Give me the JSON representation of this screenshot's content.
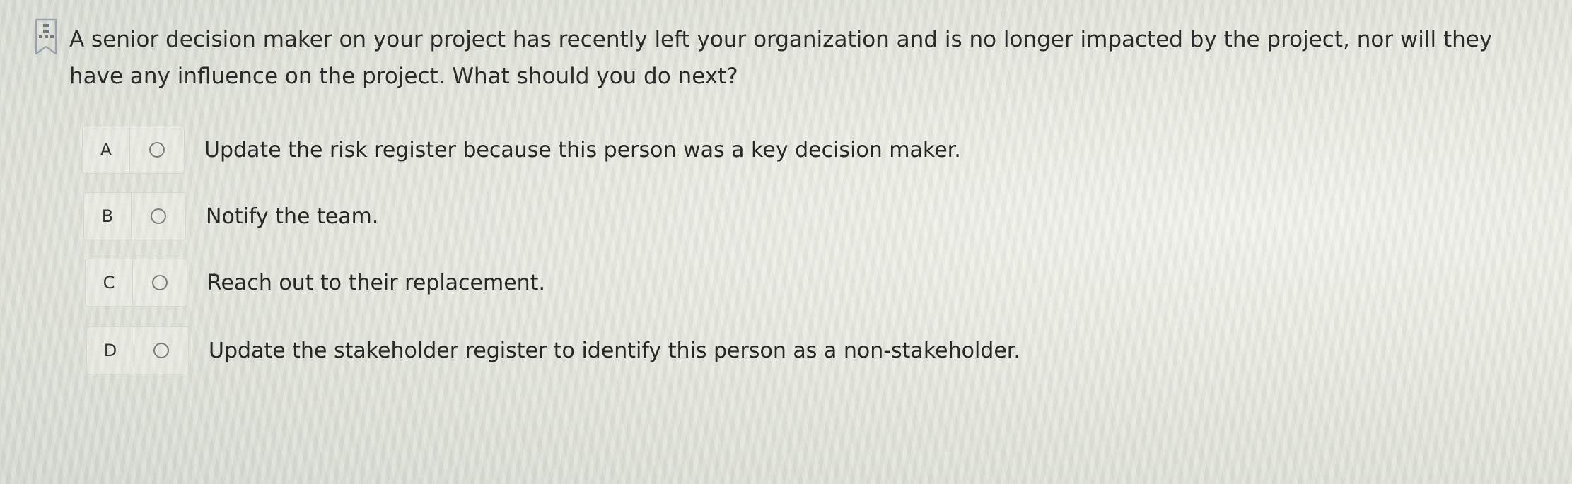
{
  "question": {
    "text": "A senior decision maker on your project has recently left your organization and is no longer impacted by the project, nor will they have any influence on the project. What should you do next?"
  },
  "options": [
    {
      "letter": "A",
      "text": "Update the risk register because this person was a key decision maker."
    },
    {
      "letter": "B",
      "text": "Notify the team."
    },
    {
      "letter": "C",
      "text": "Reach out to their replacement."
    },
    {
      "letter": "D",
      "text": "Update the stakeholder register to identify this person as a non-stakeholder."
    }
  ],
  "icons": {
    "flag": "bookmark-flag-icon",
    "radio": "radio-button-icon"
  },
  "colors": {
    "background": "#e6e9e0",
    "flag_outline": "#9aa3ad",
    "flag_dots": "#6f7780",
    "radio_border": "#7c7c7c",
    "text": "#272727"
  }
}
